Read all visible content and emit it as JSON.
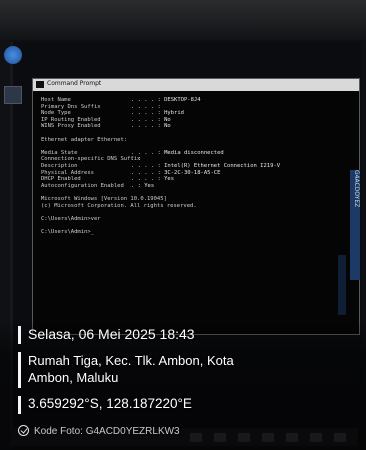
{
  "cmd": {
    "title": "Command Prompt",
    "lines": [
      {
        "k": "Host Name",
        "v": ". . . . : DESKTOP-8J4"
      },
      {
        "k": "Primary Dns Suffix",
        "v": ". . . . :"
      },
      {
        "k": "Node Type",
        "v": ". . . . : Hybrid"
      },
      {
        "k": "IP Routing Enabled",
        "v": ". . . . : No"
      },
      {
        "k": "WINS Proxy Enabled",
        "v": ". . . . : No"
      },
      {
        "k": "",
        "v": ""
      },
      {
        "k": "Ethernet adapter Ethernet:",
        "v": ""
      },
      {
        "k": "",
        "v": ""
      },
      {
        "k": "Media State",
        "v": ". . . . : Media disconnected"
      },
      {
        "k": "Connection-specific DNS Suffix",
        "v": ". :"
      },
      {
        "k": "Description",
        "v": ". . . . : Intel(R) Ethernet Connection I219-V"
      },
      {
        "k": "Physical Address",
        "v": ". . . . : 3C-2C-30-18-A5-CE"
      },
      {
        "k": "DHCP Enabled",
        "v": ". . . . : Yes"
      },
      {
        "k": "Autoconfiguration Enabled",
        "v": ". : Yes"
      },
      {
        "k": "",
        "v": ""
      },
      {
        "k": "Microsoft Windows [Version 10.0.19045]",
        "v": ""
      },
      {
        "k": "(c) Microsoft Corporation. All rights reserved.",
        "v": ""
      },
      {
        "k": "",
        "v": ""
      },
      {
        "k": "C:\\Users\\Admin>ver",
        "v": ""
      },
      {
        "k": "",
        "v": ""
      },
      {
        "k": "C:\\Users\\Admin>_",
        "v": ""
      }
    ]
  },
  "overlay": {
    "datetime": "Selasa, 06 Mei 2025 18:43",
    "address_line1": "Rumah Tiga, Kec. Tlk. Ambon, Kota",
    "address_line2": "Ambon, Maluku",
    "coords": "3.659292°S, 128.187220°E",
    "code": "Kode Foto: G4ACD0YEZRLKW3"
  },
  "right_panel_text": "G4ACDOYEZ"
}
